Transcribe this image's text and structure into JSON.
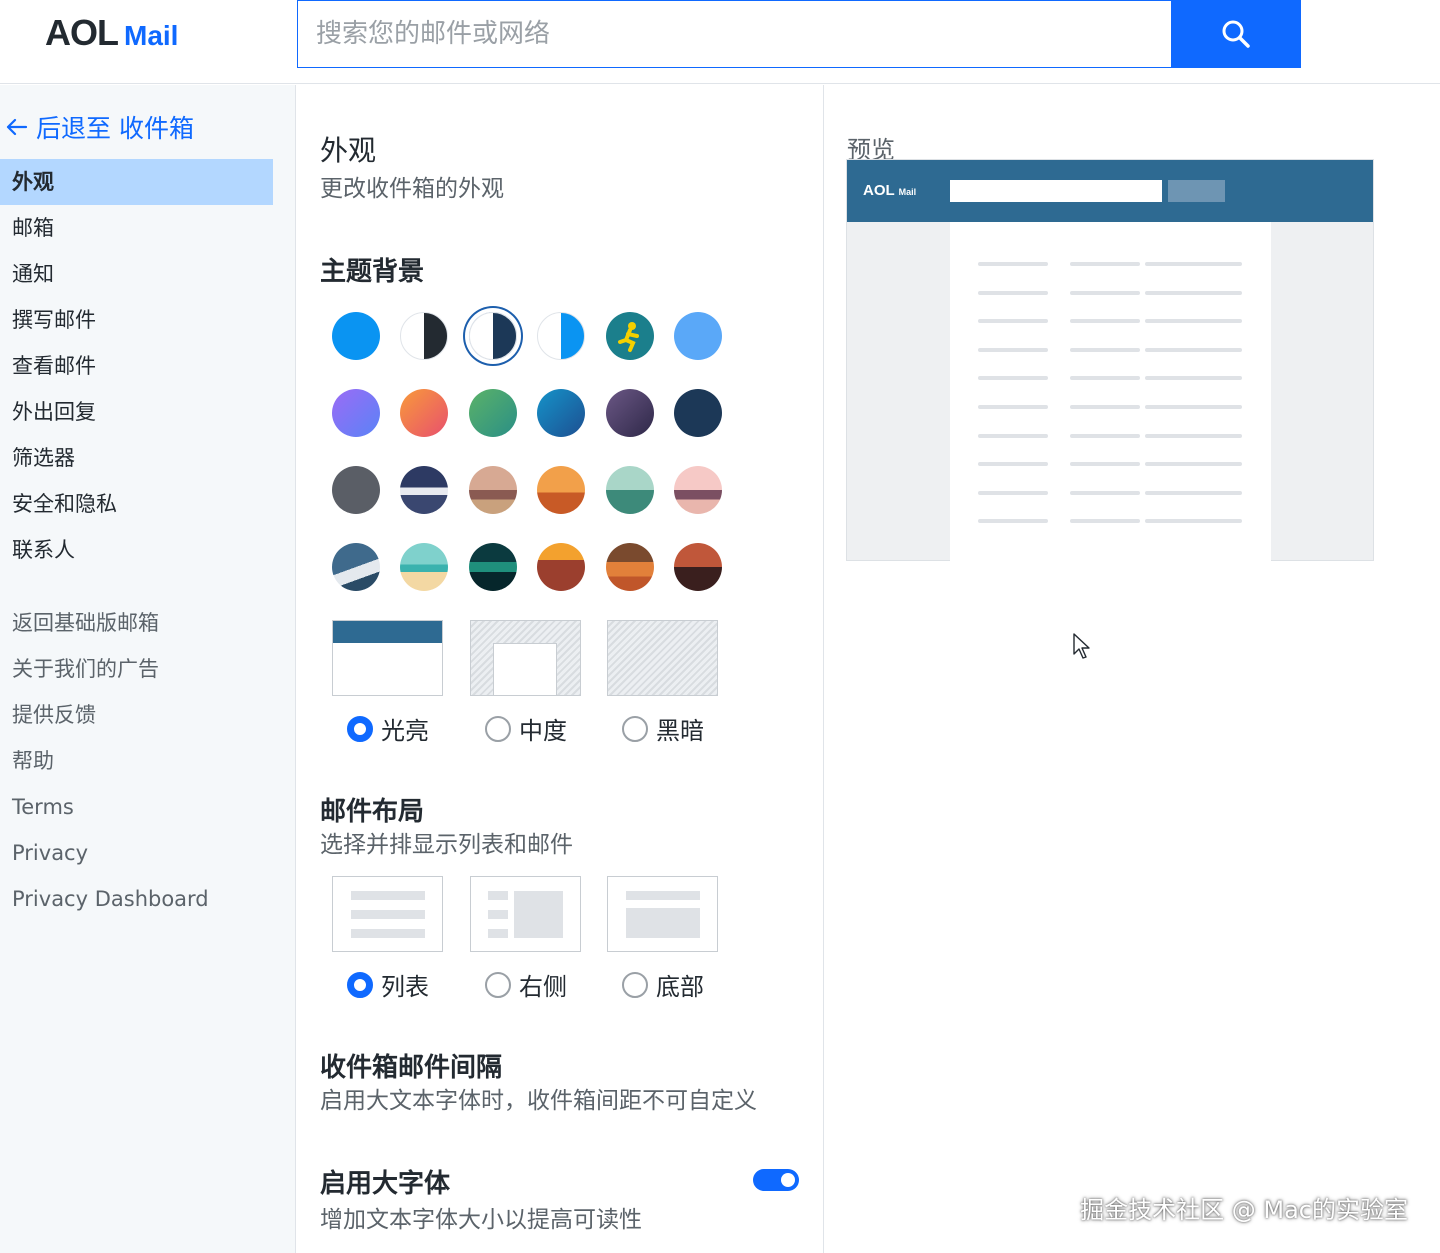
{
  "header": {
    "logo_primary": "AOL",
    "logo_secondary": "Mail",
    "search_placeholder": "搜索您的邮件或网络",
    "search_icon": "search-icon"
  },
  "sidebar": {
    "back_link": "后退至 收件箱",
    "items": [
      {
        "label": "外观",
        "active": true
      },
      {
        "label": "邮箱"
      },
      {
        "label": "通知"
      },
      {
        "label": "撰写邮件"
      },
      {
        "label": "查看邮件"
      },
      {
        "label": "外出回复"
      },
      {
        "label": "筛选器"
      },
      {
        "label": "安全和隐私"
      },
      {
        "label": "联系人"
      }
    ],
    "secondary_items": [
      {
        "label": "返回基础版邮箱"
      },
      {
        "label": "关于我们的广告"
      },
      {
        "label": "提供反馈"
      },
      {
        "label": "帮助"
      },
      {
        "label": "Terms"
      },
      {
        "label": "Privacy"
      },
      {
        "label": "Privacy Dashboard"
      }
    ]
  },
  "main": {
    "title": "外观",
    "subtitle": "更改收件箱的外观",
    "theme_heading": "主题背景",
    "theme_colors": [
      "#0a94f2",
      "half-dark",
      "half-navy-selected",
      "half-blue",
      "aim-runner",
      "#5aa8f8",
      "#7b6df5",
      "#ee6b4d",
      "#3aa37a",
      "#1d7bb8",
      "#4b3c6a",
      "#1c3857",
      "#5a5e66",
      "mountains",
      "desert-car",
      "kangaroo",
      "lighthouse",
      "birds",
      "snow-hill",
      "beach",
      "aurora",
      "moon-sunset",
      "cactus",
      "camels"
    ],
    "mode_options": [
      {
        "label": "光亮",
        "selected": true
      },
      {
        "label": "中度",
        "selected": false
      },
      {
        "label": "黑暗",
        "selected": false
      }
    ],
    "layout_heading": "邮件布局",
    "layout_subtitle": "选择并排显示列表和邮件",
    "layout_options": [
      {
        "label": "列表",
        "selected": true
      },
      {
        "label": "右侧",
        "selected": false
      },
      {
        "label": "底部",
        "selected": false
      }
    ],
    "spacing_heading": "收件箱邮件间隔",
    "spacing_subtitle": "启用大文本字体时，收件箱间距不可自定义",
    "large_font_heading": "启用大字体",
    "large_font_subtitle": "增加文本字体大小以提高可读性",
    "large_font_enabled": true
  },
  "preview": {
    "label": "预览",
    "logo_primary": "AOL",
    "logo_secondary": "Mail",
    "bar_color": "#2e6a92"
  },
  "watermark": "掘金技术社区 @ Mac的实验室"
}
